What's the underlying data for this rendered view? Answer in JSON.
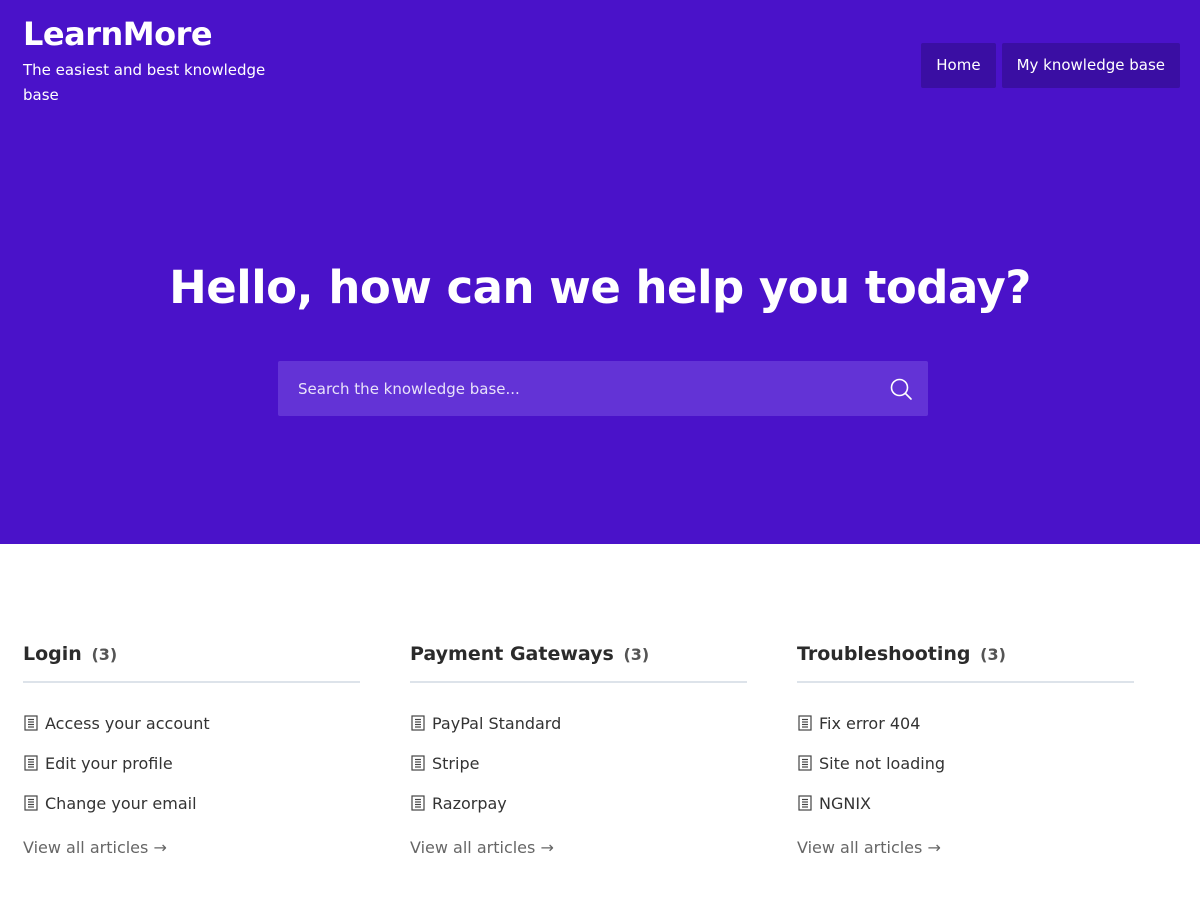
{
  "brand": {
    "title": "LearnMore",
    "tagline": "The easiest and best knowledge base"
  },
  "nav": {
    "items": [
      {
        "label": "Home"
      },
      {
        "label": "My knowledge base"
      }
    ]
  },
  "hero": {
    "heading": "Hello, how can we help you today?",
    "search_placeholder": "Search the knowledge base..."
  },
  "categories": [
    {
      "name": "Login",
      "count": "(3)",
      "articles": [
        "Access your account",
        "Edit your profile",
        "Change your email"
      ],
      "view_all": "View all articles →"
    },
    {
      "name": "Payment Gateways",
      "count": "(3)",
      "articles": [
        "PayPal Standard",
        "Stripe",
        "Razorpay"
      ],
      "view_all": "View all articles →"
    },
    {
      "name": "Troubleshooting",
      "count": "(3)",
      "articles": [
        "Fix error 404",
        "Site not loading",
        "NGNIX"
      ],
      "view_all": "View all articles →"
    }
  ],
  "colors": {
    "hero_background": "#4a12c9",
    "nav_button": "#3a0ea3",
    "search_background": "#6333d6"
  },
  "icons": {
    "search": "search-icon",
    "article": "document-icon"
  }
}
